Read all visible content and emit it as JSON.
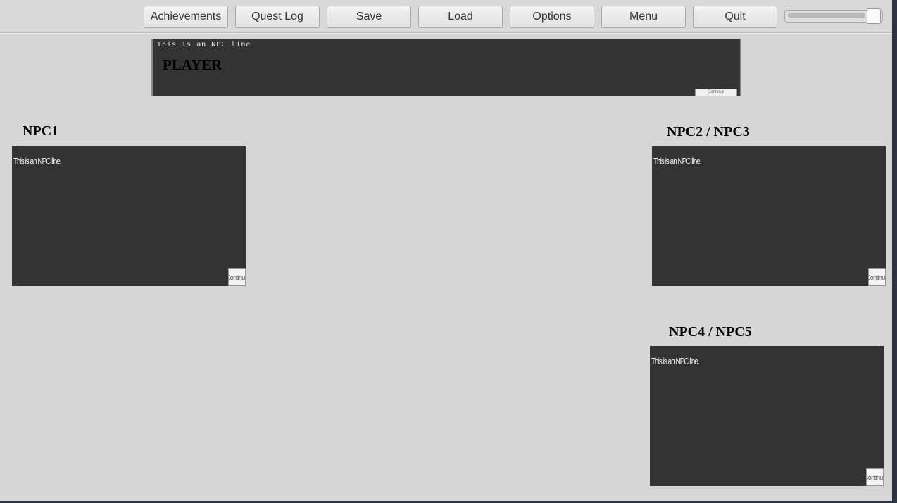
{
  "toolbar": {
    "buttons": [
      "Achievements",
      "Quest Log",
      "Save",
      "Load",
      "Options",
      "Menu",
      "Quit"
    ],
    "volume_level": 0.92
  },
  "player_panel": {
    "line": "This is an NPC line.",
    "name": "PLAYER",
    "continue_label": "Continue"
  },
  "npc_panels": [
    {
      "label": "NPC1",
      "line": "This is an NPC line.",
      "continue_label": "Continue"
    },
    {
      "label": "NPC2 / NPC3",
      "line": "This is an NPC line.",
      "continue_label": "Continue"
    },
    {
      "label": "NPC4 / NPC5",
      "line": "This is an NPC line.",
      "continue_label": "Continue"
    }
  ]
}
